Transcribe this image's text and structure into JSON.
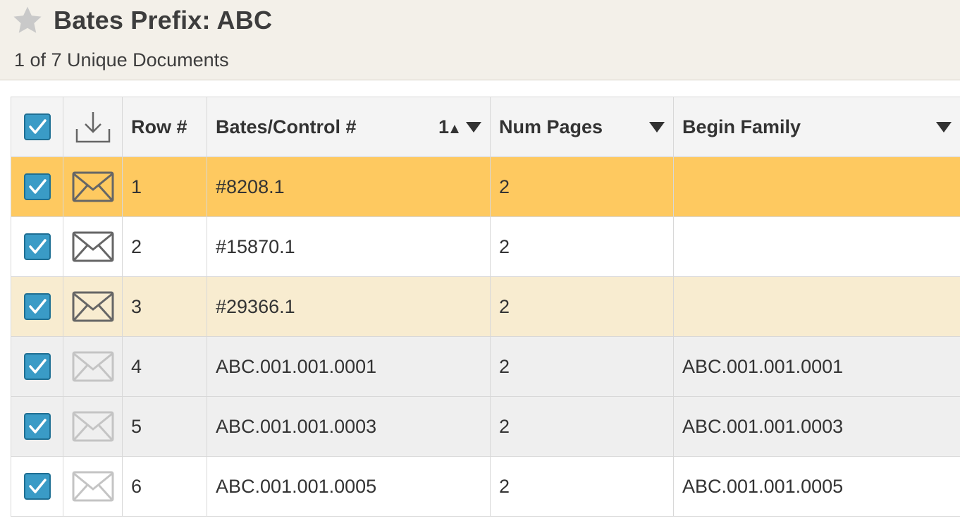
{
  "header": {
    "title": "Bates Prefix: ABC",
    "subtitle": "1 of 7 Unique Documents",
    "star_icon": "star-icon"
  },
  "colors": {
    "header_bg": "#f3f0e9",
    "selected_row": "#fec960",
    "highlight_row": "#f8ecd0",
    "alt_row": "#efefef",
    "checkbox": "#3a9bc6"
  },
  "table": {
    "columns": {
      "row_num": "Row #",
      "bates": "Bates/Control #",
      "bates_sort": "1",
      "num_pages": "Num Pages",
      "begin_family": "Begin Family",
      "download_icon": "download-icon"
    },
    "rows": [
      {
        "row": "1",
        "bates": "#8208.1",
        "pages": "2",
        "family": "",
        "checked": true,
        "icon": "envelope-icon",
        "state": "selected"
      },
      {
        "row": "2",
        "bates": "#15870.1",
        "pages": "2",
        "family": "",
        "checked": true,
        "icon": "envelope-icon",
        "state": "normal"
      },
      {
        "row": "3",
        "bates": "#29366.1",
        "pages": "2",
        "family": "",
        "checked": true,
        "icon": "envelope-icon",
        "state": "highlight"
      },
      {
        "row": "4",
        "bates": "ABC.001.001.0001",
        "pages": "2",
        "family": "ABC.001.001.0001",
        "checked": true,
        "icon": "envelope-icon-light",
        "state": "grey"
      },
      {
        "row": "5",
        "bates": "ABC.001.001.0003",
        "pages": "2",
        "family": "ABC.001.001.0003",
        "checked": true,
        "icon": "envelope-icon-light",
        "state": "grey"
      },
      {
        "row": "6",
        "bates": "ABC.001.001.0005",
        "pages": "2",
        "family": "ABC.001.001.0005",
        "checked": true,
        "icon": "envelope-icon-light",
        "state": "normal"
      }
    ]
  }
}
